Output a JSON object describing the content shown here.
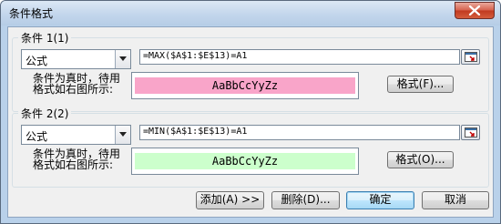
{
  "window": {
    "title": "条件格式"
  },
  "conditions": [
    {
      "legend": "条件 1(1)",
      "type": "公式",
      "formula": "=MAX($A$1:$E$13)=A1",
      "desc_line1": "条件为真时，待用",
      "desc_line2": "格式如右图所示:",
      "preview_text": "AaBbCcYyZz",
      "preview_color": "#f9a5c9",
      "format_button": "格式(F)..."
    },
    {
      "legend": "条件 2(2)",
      "type": "公式",
      "formula": "=MIN($A$1:$E$13)=A1",
      "desc_line1": "条件为真时，待用",
      "desc_line2": "格式如右图所示:",
      "preview_text": "AaBbCcYyZz",
      "preview_color": "#ccffcc",
      "format_button": "格式(O)..."
    }
  ],
  "buttons": {
    "add": "添加(A) >>",
    "delete": "删除(D)...",
    "ok": "确定",
    "cancel": "取消"
  }
}
